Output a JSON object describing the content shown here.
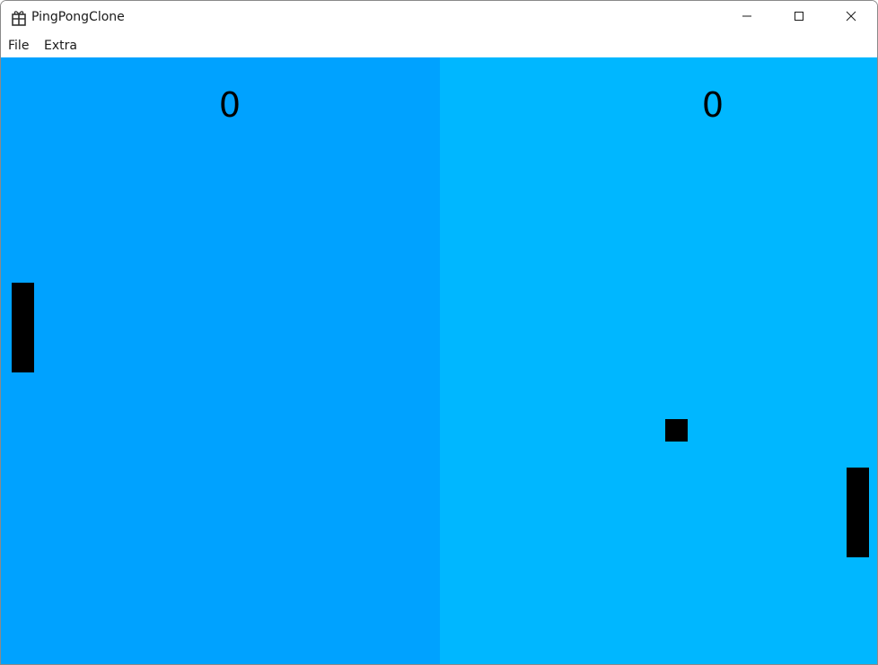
{
  "window": {
    "title": "PingPongClone",
    "icon": "gift-icon"
  },
  "titlebar_buttons": {
    "minimize": "minimize-icon",
    "maximize": "maximize-icon",
    "close": "close-icon"
  },
  "menu": {
    "items": [
      {
        "label": "File"
      },
      {
        "label": "Extra"
      }
    ]
  },
  "game": {
    "left_score": "0",
    "right_score": "0",
    "colors": {
      "left_half": "#00A2FF",
      "right_half": "#00B7FF",
      "paddles": "#000000",
      "ball": "#000000"
    }
  }
}
